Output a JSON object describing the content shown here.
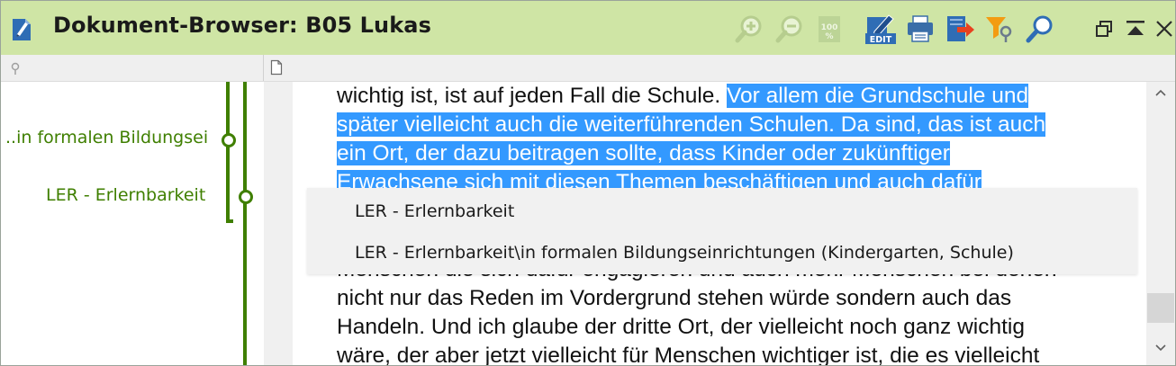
{
  "window": {
    "title": "Dokument-Browser: B05 Lukas"
  },
  "toolbar": {
    "icons": [
      "zoom-in-icon",
      "zoom-out-icon",
      "zoom-100-icon",
      "edit-icon",
      "print-icon",
      "export-icon",
      "filter-icon",
      "search-icon",
      "restore-window-icon",
      "collapse-icon",
      "close-icon"
    ],
    "zoom_label": "100",
    "edit_label": "EDIT"
  },
  "codes": {
    "items": [
      {
        "label": "..in formalen Bildungseiı"
      },
      {
        "label": "LER - Erlernbarkeit"
      }
    ],
    "color": "#3f7f00"
  },
  "document": {
    "lines": [
      {
        "plain": "wichtig ist, ist auf jeden Fall die Schule. ",
        "highlight": "Vor allem die Grundschule und"
      },
      {
        "plain": "",
        "highlight": "später vielleicht auch die weiterführenden Schulen. Da sind, das ist auch"
      },
      {
        "plain": "",
        "highlight": "ein Ort, der dazu beitragen sollte, dass Kinder oder zukünftiger"
      },
      {
        "plain": "",
        "highlight": "Erwachsene sich mit diesen Themen beschäftigen und auch dafür"
      },
      {
        "plain": "Menschen die sich dafür engagieren und auch mehr Menschen bei denen",
        "highlight": ""
      },
      {
        "plain": "nicht nur das Reden im Vordergrund stehen würde sondern auch das",
        "highlight": ""
      },
      {
        "plain": "Handeln. Und ich glaube der dritte Ort, der vielleicht noch ganz wichtig",
        "highlight": ""
      },
      {
        "plain": "wäre, der aber jetzt vielleicht für Menschen wichtiger ist, die es vielleicht",
        "highlight": ""
      }
    ],
    "highlight_color": "#3399ff"
  },
  "popup": {
    "items": [
      "LER - Erlernbarkeit",
      "LER - Erlernbarkeit\\in formalen Bildungseinrichtungen (Kindergarten, Schule)"
    ]
  }
}
